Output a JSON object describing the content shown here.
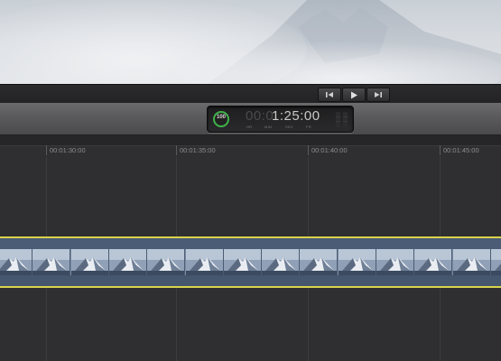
{
  "transport": {
    "prev_icon": "skip-back-icon",
    "play_icon": "play-icon",
    "next_icon": "skip-forward-icon"
  },
  "timecode": {
    "zoom_percent": "100",
    "hidden_digits": "00:0",
    "current": "1:25:00",
    "units": [
      "HR",
      "MIN",
      "SEC",
      "FR"
    ],
    "ring_color": "#3fb34a"
  },
  "ruler": {
    "labels": [
      "00:01:30:00",
      "00:01:35:00",
      "00:01:40:00",
      "00:01:45:00"
    ]
  },
  "clip": {
    "border_color": "#d9d34a",
    "body_color": "#45566f"
  }
}
